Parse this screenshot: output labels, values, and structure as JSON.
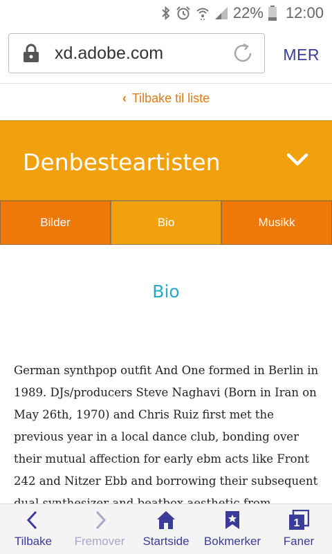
{
  "status_bar": {
    "battery_percent": "22%",
    "time": "12:00",
    "icons": [
      "bluetooth-icon",
      "alarm-icon",
      "wifi-icon",
      "signal-icon",
      "battery-icon"
    ]
  },
  "browser": {
    "url": "xd.adobe.com",
    "more_label": "MER",
    "icons": [
      "lock-icon",
      "reload-icon"
    ]
  },
  "page": {
    "back_label": "Tilbake til liste",
    "artist_name": "Denbesteartisten",
    "tabs": [
      {
        "label": "Bilder",
        "active": false
      },
      {
        "label": "Bio",
        "active": true
      },
      {
        "label": "Musikk",
        "active": false
      }
    ],
    "section_title": "Bio",
    "bio_text": "German synthpop outfit And One formed in Berlin in 1989. DJs/producers Steve Naghavi (Born in Iran on May 26th, 1970) and Chris Ruiz first met the previous year in a local dance club, bonding over their mutual affection for early ebm acts like Front 242 and Nitzer Ebb and borrowing their subsequent dual synthesizer and beatbox aesthetic from"
  },
  "bottom_nav": [
    {
      "label": "Tilbake",
      "icon": "back-arrow-icon",
      "enabled": true
    },
    {
      "label": "Fremover",
      "icon": "forward-arrow-icon",
      "enabled": false
    },
    {
      "label": "Startside",
      "icon": "home-icon",
      "enabled": true
    },
    {
      "label": "Bokmerker",
      "icon": "bookmark-icon",
      "enabled": true
    },
    {
      "label": "Faner",
      "icon": "tabs-icon",
      "enabled": true
    }
  ],
  "colors": {
    "accent_orange": "#f2a10e",
    "tab_orange": "#ee7808",
    "link_orange": "#e07b15",
    "title_teal": "#2aa8c6",
    "nav_blue": "#3b3b9a"
  }
}
